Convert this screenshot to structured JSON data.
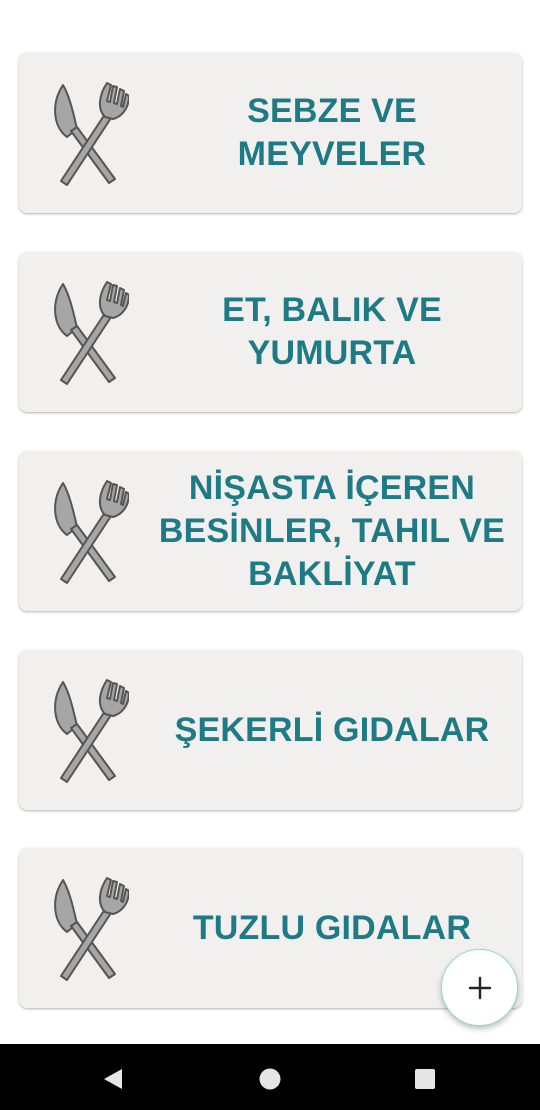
{
  "categories": [
    {
      "label": "SEBZE VE\nMEYVELER",
      "icon": "cutlery-icon"
    },
    {
      "label": "ET, BALIK VE\nYUMURTA",
      "icon": "cutlery-icon"
    },
    {
      "label": "NİŞASTA İÇEREN\nBESİNLER, TAHIL VE\nBAKLİYAT",
      "icon": "cutlery-icon"
    },
    {
      "label": "ŞEKERLİ GIDALAR",
      "icon": "cutlery-icon"
    },
    {
      "label": "TUZLU GIDALAR",
      "icon": "cutlery-icon"
    }
  ],
  "fab": {
    "icon": "plus-icon"
  },
  "navigation_bar": {
    "buttons": [
      "back-icon",
      "home-icon",
      "recents-icon"
    ]
  },
  "colors": {
    "label_text": "#1e7a85",
    "card_background": "#f2f0ee",
    "fab_border": "#8fd9d2",
    "navigation_bar": "#000000"
  }
}
